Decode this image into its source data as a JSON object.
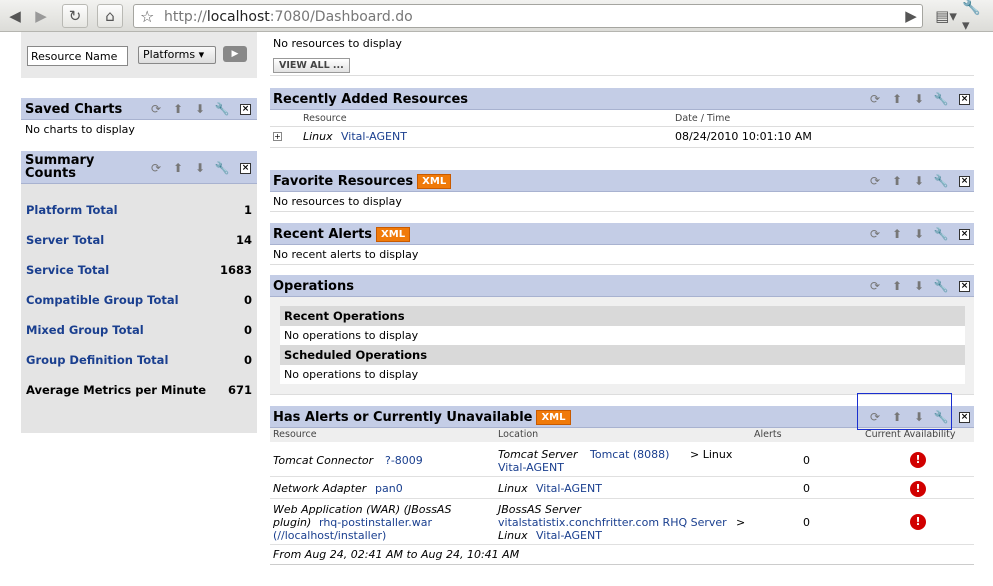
{
  "browser": {
    "url_prefix": "http://",
    "url_host": "localhost",
    "url_rest": ":7080/Dashboard.do"
  },
  "search": {
    "resource_name_value": "Resource Name",
    "platform_select": "Platforms"
  },
  "saved_charts": {
    "title": "Saved Charts",
    "empty_text": "No charts to display"
  },
  "summary": {
    "title_line1": "Summary",
    "title_line2": "Counts",
    "rows": [
      {
        "label": "Platform Total",
        "value": "1"
      },
      {
        "label": "Server Total",
        "value": "14"
      },
      {
        "label": "Service Total",
        "value": "1683"
      },
      {
        "label": "Compatible Group Total",
        "value": "0"
      },
      {
        "label": "Mixed Group Total",
        "value": "0"
      },
      {
        "label": "Group Definition Total",
        "value": "0"
      },
      {
        "label": "Average Metrics per Minute",
        "value": "671"
      }
    ]
  },
  "top_portlet": {
    "empty_text": "No resources to display",
    "view_all": "VIEW ALL ..."
  },
  "recently_added": {
    "title": "Recently Added Resources",
    "col_resource": "Resource",
    "col_datetime": "Date / Time",
    "row": {
      "type": "Linux",
      "name": "Vital-AGENT",
      "datetime": "08/24/2010 10:01:10 AM"
    }
  },
  "favorites": {
    "title": "Favorite Resources",
    "xml": "XML",
    "empty_text": "No resources to display"
  },
  "recent_alerts": {
    "title": "Recent Alerts",
    "xml": "XML",
    "empty_text": "No recent alerts to display"
  },
  "operations": {
    "title": "Operations",
    "recent_title": "Recent Operations",
    "recent_empty": "No operations to display",
    "scheduled_title": "Scheduled Operations",
    "scheduled_empty": "No operations to display"
  },
  "alerts_unavailable": {
    "title": "Has Alerts or Currently Unavailable",
    "xml": "XML",
    "col_resource": "Resource",
    "col_location": "Location",
    "col_alerts": "Alerts",
    "col_availability": "Current Availability",
    "rows": [
      {
        "type": "Tomcat Connector",
        "name": "?-8009",
        "loc_type": "Tomcat Server",
        "loc_name": "Tomcat (8088)",
        "loc_sep": "> Linux",
        "loc_agent": "Vital-AGENT",
        "alerts": "0"
      },
      {
        "type": "Network Adapter",
        "name": "pan0",
        "loc_type": "Linux",
        "loc_name": "Vital-AGENT",
        "alerts": "0"
      },
      {
        "type_line1": "Web Application (WAR) (JBossAS",
        "type_line2": "plugin)",
        "name_line1": "rhq-postinstaller.war",
        "name_line2": "(//localhost/installer)",
        "loc_type": "JBossAS Server",
        "loc_name": "vitalstatistix.conchfritter.com RHQ Server",
        "loc_sep": ">",
        "loc_line3_type": "Linux",
        "loc_agent": "Vital-AGENT",
        "alerts": "0"
      }
    ],
    "footer": "From Aug 24, 02:41 AM to Aug 24, 10:41 AM"
  }
}
